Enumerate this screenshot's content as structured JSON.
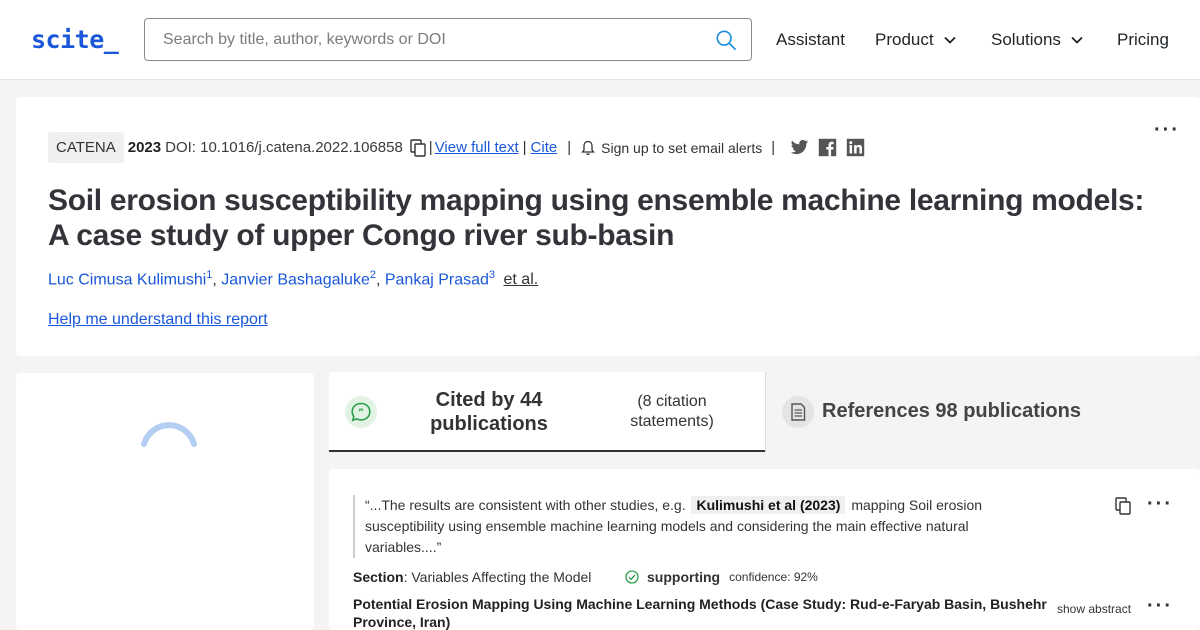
{
  "header": {
    "logo": "scite_",
    "search_placeholder": "Search by title, author, keywords or DOI",
    "nav": {
      "assistant": "Assistant",
      "product": "Product",
      "solutions": "Solutions",
      "pricing": "Pricing"
    }
  },
  "paper": {
    "journal": "CATENA",
    "year": "2023",
    "doi": "DOI: 10.1016/j.catena.2022.106858",
    "view_full_text": "View full text",
    "cite": "Cite",
    "alert_text": "Sign up to set email alerts",
    "title": "Soil erosion susceptibility mapping using ensemble machine learning models: A case study of upper Congo river sub-basin",
    "authors": [
      {
        "name": "Luc Cimusa Kulimushi",
        "sup": "1"
      },
      {
        "name": "Janvier Bashagaluke",
        "sup": "2"
      },
      {
        "name": "Pankaj Prasad",
        "sup": "3"
      }
    ],
    "et_al": "et al.",
    "help_link": "Help me understand this report"
  },
  "tabs": {
    "cited_by": "Cited by 44 publications",
    "citation_statements": "(8 citation statements)",
    "references": "References 98 publications"
  },
  "citation": {
    "quote_pre": "“...The results are consistent with other studies, e.g.",
    "quote_highlight": "Kulimushi et al (2023)",
    "quote_post": "mapping Soil erosion susceptibility using ensemble machine learning models and considering the main effective natural variables....”",
    "section_label": "Section",
    "section_value": ": Variables Affecting the Model",
    "classification": "supporting",
    "confidence": "confidence: 92%",
    "citing_title": "Potential Erosion Mapping Using Machine Learning Methods (Case Study: Rud-e-Faryab Basin, Bushehr Province, Iran)",
    "show_abstract": "show abstract"
  },
  "colors": {
    "brand": "#1a58d9",
    "supporting": "#2e9e4f"
  },
  "icons": [
    "search-icon",
    "chevron-down-icon",
    "copy-icon",
    "bell-icon",
    "twitter-icon",
    "facebook-icon",
    "linkedin-icon",
    "more-icon",
    "quote-bubble-icon",
    "document-icon",
    "check-circle-icon",
    "loading-spinner"
  ]
}
